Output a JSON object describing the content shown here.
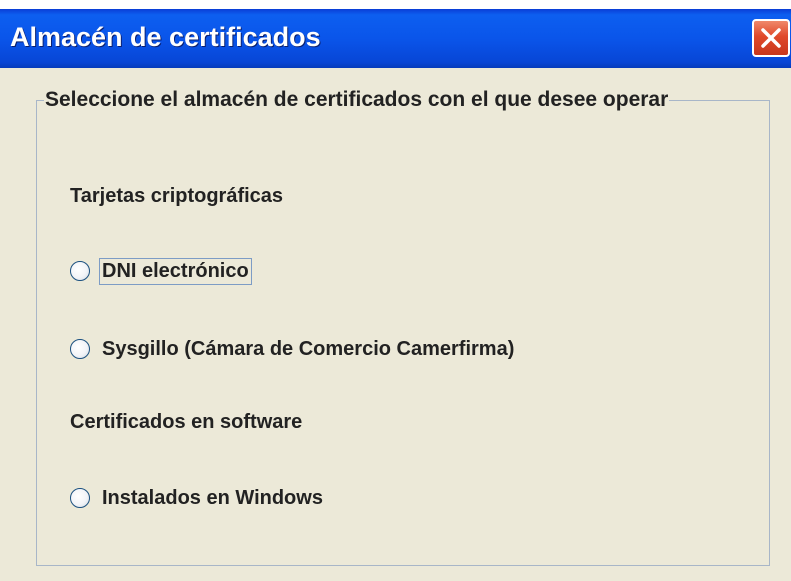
{
  "window": {
    "title": "Almacén de certificados",
    "close_icon": "close-icon",
    "colors": {
      "titlebar": "#0a55ea",
      "close_button": "#e0492a",
      "background": "#ece9d8",
      "text": "#222222"
    }
  },
  "group": {
    "legend": "Seleccione el almacén de certificados con el que desee operar"
  },
  "sections": {
    "cards_label": "Tarjetas criptográficas",
    "software_label": "Certificados en software"
  },
  "options": {
    "dnie": {
      "label": "DNI electrónico",
      "selected": false,
      "focused": true
    },
    "sysgillo": {
      "label": "Sysgillo (Cámara de Comercio Camerfirma)",
      "selected": false
    },
    "windows": {
      "label": "Instalados en Windows",
      "selected": false
    }
  }
}
